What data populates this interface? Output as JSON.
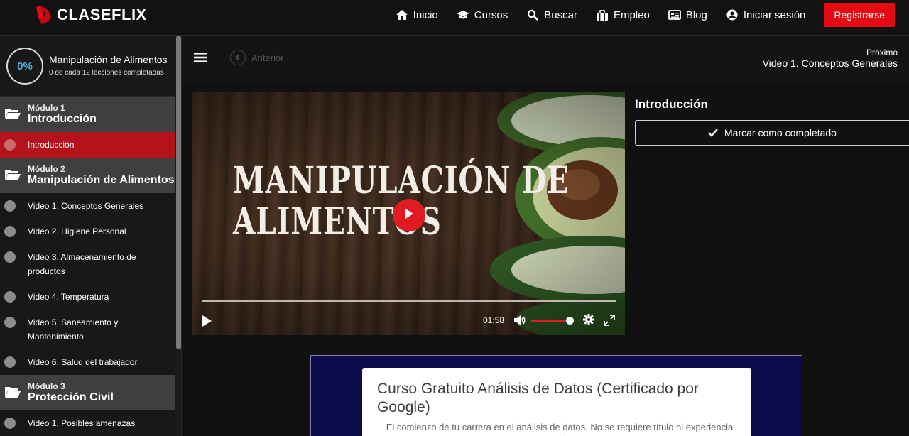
{
  "brand": {
    "name": "CLASEFLIX",
    "accent": "#e50914"
  },
  "nav": {
    "items": [
      {
        "label": "Inicio",
        "icon": "home-icon"
      },
      {
        "label": "Cursos",
        "icon": "graduation-cap-icon"
      },
      {
        "label": "Buscar",
        "icon": "search-icon"
      },
      {
        "label": "Empleo",
        "icon": "briefcase-icon"
      },
      {
        "label": "Blog",
        "icon": "newspaper-icon"
      },
      {
        "label": "Iniciar sesión",
        "icon": "user-circle-icon"
      }
    ],
    "register_label": "Registrarse"
  },
  "course": {
    "progress_text": "0%",
    "progress_fraction": 0,
    "title": "Manipulación de Alimentos",
    "subtitle": "0 de cada 12 lecciones completadas"
  },
  "modules": [
    {
      "label": "Módulo 1",
      "title": "Introducción",
      "lessons": [
        {
          "label": "Introducción",
          "active": true
        }
      ]
    },
    {
      "label": "Módulo 2",
      "title": "Manipulación de Alimentos",
      "lessons": [
        {
          "label": "Video 1. Conceptos Generales"
        },
        {
          "label": "Video 2. Higiene Personal"
        },
        {
          "label": "Video 3. Almacenamiento de productos"
        },
        {
          "label": "Video 4. Temperatura"
        },
        {
          "label": "Video 5. Saneamiento y Mantenimiento"
        },
        {
          "label": "Video 6. Salud del trabajador"
        }
      ]
    },
    {
      "label": "Módulo 3",
      "title": "Protección Civil",
      "lessons": [
        {
          "label": "Video 1. Posibles amenazas"
        }
      ]
    }
  ],
  "toolbar": {
    "prev_label": "Anterior",
    "next_caption": "Próximo",
    "next_title": "Video 1. Conceptos Generales"
  },
  "video": {
    "title_line1": "MANIPULACIÓN DE",
    "title_line2": "ALIMENTOS",
    "time": "01:58",
    "volume_fraction": 0.9,
    "progress_fraction": 0
  },
  "lesson_panel": {
    "title": "Introducción",
    "mark_complete_label": "Marcar como completado"
  },
  "ad": {
    "title": "Curso Gratuito Análisis de Datos (Certificado por Google)",
    "description": "El comienzo de tu carrera en el análisis de datos. No se requiere título ni experiencia previa."
  }
}
